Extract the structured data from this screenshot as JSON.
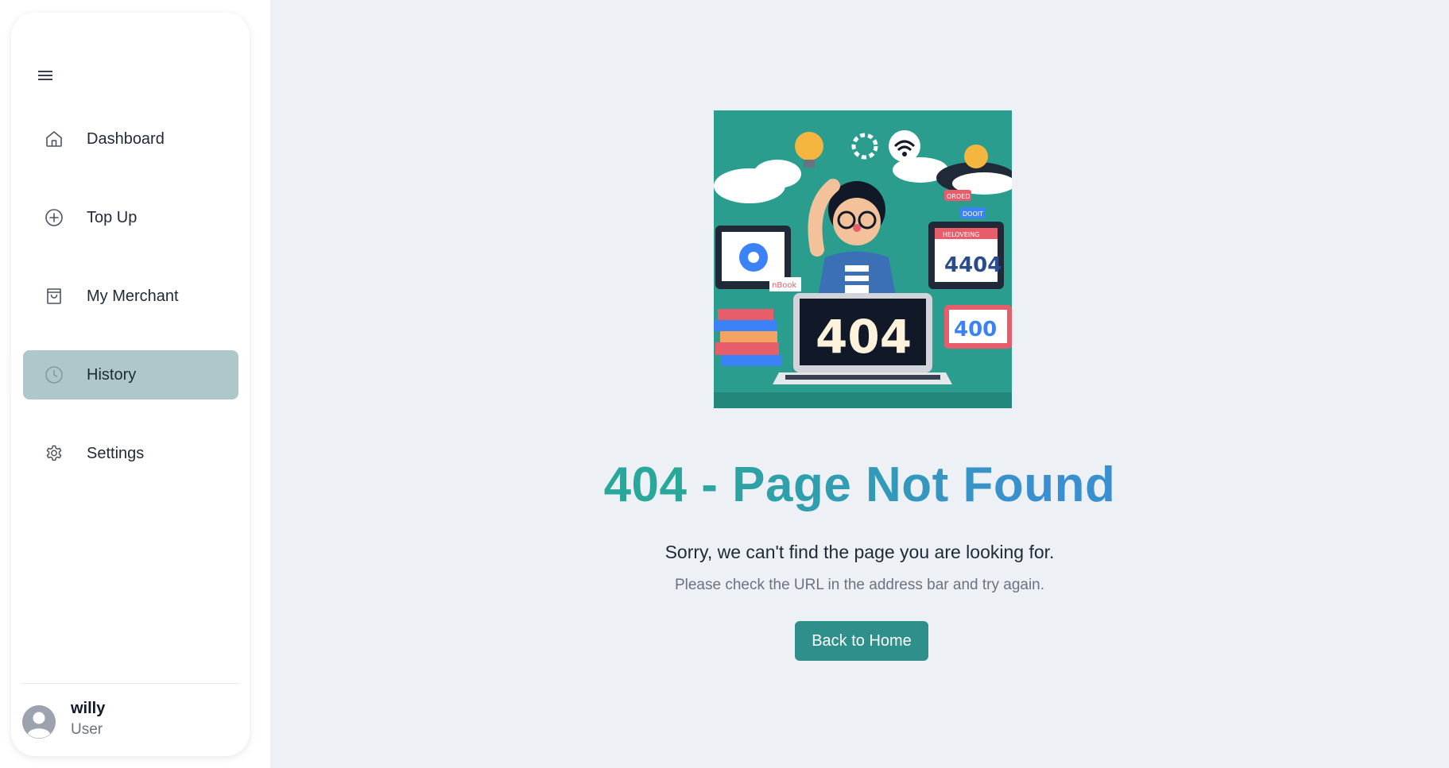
{
  "sidebar": {
    "menu_icon": "hamburger-menu-icon",
    "items": [
      {
        "label": "Dashboard",
        "icon": "home-icon",
        "active": false
      },
      {
        "label": "Top Up",
        "icon": "plus-circle-icon",
        "active": false
      },
      {
        "label": "My Merchant",
        "icon": "shopping-bag-icon",
        "active": false
      },
      {
        "label": "History",
        "icon": "clock-icon",
        "active": true
      },
      {
        "label": "Settings",
        "icon": "gear-icon",
        "active": false
      }
    ],
    "user": {
      "name": "willy",
      "role": "User",
      "avatar_icon": "user-avatar-icon"
    }
  },
  "main": {
    "illustration": {
      "texts": [
        "404",
        "4404",
        "400",
        "HELOVEING",
        "OROED",
        "DOOIT",
        "nBook"
      ]
    },
    "title": "404 - Page Not Found",
    "message": "Sorry, we can't find the page you are looking for.",
    "hint": "Please check the URL in the address bar and try again.",
    "button_label": "Back to Home"
  },
  "colors": {
    "active_nav_bg": "#aec8c9",
    "button_bg": "#2f8f8a",
    "title_gradient_start": "#2aa79b",
    "title_gradient_end": "#3a8fd0",
    "main_bg": "#edf1f5"
  }
}
